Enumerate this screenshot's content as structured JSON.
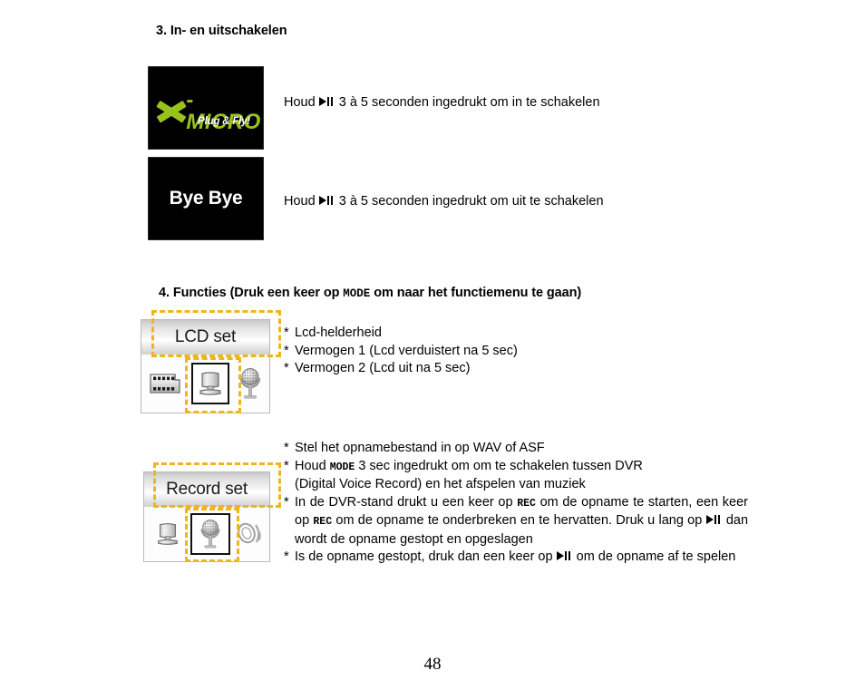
{
  "document": {
    "page_number": "48"
  },
  "section3": {
    "heading": "3. In- en uitschakelen",
    "screen_on": {
      "brand_x": "X",
      "brand_text": "- MICRO",
      "tagline": "Plug & Fly!"
    },
    "screen_off": {
      "text": "Bye Bye"
    },
    "line_on": {
      "before": "Houd",
      "key": "play-pause",
      "after": "3 à 5 seconden ingedrukt om in te schakelen"
    },
    "line_off": {
      "before": "Houd",
      "key": "play-pause",
      "after": "3 à 5 seconden ingedrukt om uit te schakelen"
    }
  },
  "section4": {
    "heading_before": "4. Functies (Druk een keer op",
    "heading_key": "MODE",
    "heading_after": "om naar het functiemenu te gaan)",
    "lcd_panel": {
      "title": "LCD set",
      "icons": [
        {
          "name": "film-strip-icon",
          "selected": false
        },
        {
          "name": "lcd-monitor-icon",
          "selected": true
        },
        {
          "name": "microphone-icon",
          "selected": false
        }
      ]
    },
    "lcd_bullets": [
      "Lcd-helderheid",
      "Vermogen 1 (Lcd verduistert na 5 sec)",
      "Vermogen 2 (Lcd uit na 5 sec)"
    ],
    "record_panel": {
      "title": "Record set",
      "icons": [
        {
          "name": "lcd-monitor-icon",
          "selected": false
        },
        {
          "name": "microphone-icon",
          "selected": true
        },
        {
          "name": "speaker-sound-icon",
          "selected": false
        }
      ]
    },
    "record_bullets": {
      "b1": "Stel het opnamebestand in op WAV of ASF",
      "b2_before": "Houd",
      "b2_key": "MODE",
      "b2_after": "3 sec ingedrukt om om te schakelen tussen DVR",
      "b2_line2": "(Digital Voice Record) en het afspelen van muziek",
      "b3_p1": "In de DVR-stand drukt u een keer op",
      "b3_key1": "REC",
      "b3_p2": "om de opname te starten, een keer op",
      "b3_key2": "REC",
      "b3_p3": "om de opname te onderbreken en te hervatten. Druk u lang op",
      "b3_key3": "play-pause",
      "b3_p4": "dan wordt de opname gestopt en opgeslagen",
      "b4_p1": "Is de opname gestopt, druk dan een keer op",
      "b4_key1": "play-pause",
      "b4_p2": "om de opname af te spelen"
    }
  },
  "colors": {
    "brand_green": "#9ac21c",
    "selection_gold": "#f0b51c",
    "screen_black": "#000000"
  }
}
